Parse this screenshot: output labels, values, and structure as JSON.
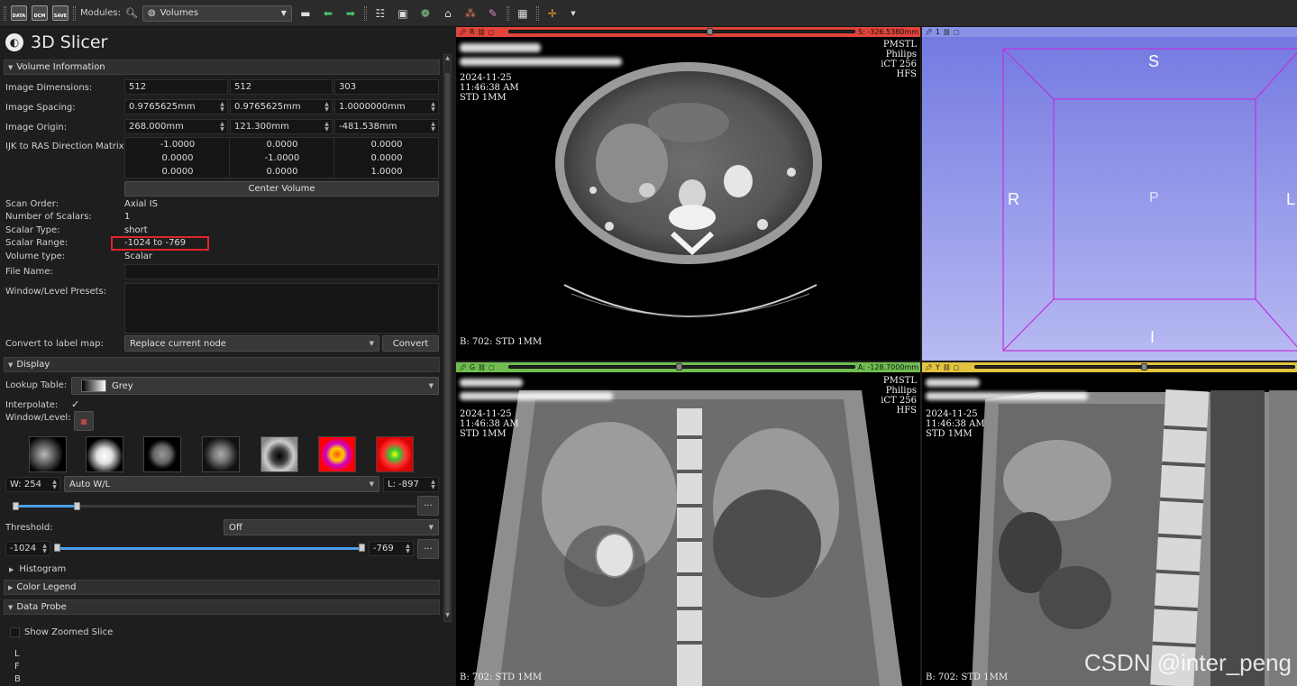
{
  "toolbar": {
    "data_label": "DATA",
    "dcm_label": "DCM",
    "save_label": "SAVE",
    "modules_label": "Modules:",
    "module_selected": "Volumes"
  },
  "app": {
    "title": "3D Slicer"
  },
  "volume_info": {
    "header": "Volume Information",
    "image_dimensions_label": "Image Dimensions:",
    "image_dimensions": [
      "512",
      "512",
      "303"
    ],
    "image_spacing_label": "Image Spacing:",
    "image_spacing": [
      "0.9765625mm",
      "0.9765625mm",
      "1.0000000mm"
    ],
    "image_origin_label": "Image Origin:",
    "image_origin": [
      "268.000mm",
      "121.300mm",
      "-481.538mm"
    ],
    "ijk_label": "IJK to RAS Direction Matrix:",
    "matrix": [
      [
        "-1.0000",
        "0.0000",
        "0.0000"
      ],
      [
        "0.0000",
        "-1.0000",
        "0.0000"
      ],
      [
        "0.0000",
        "0.0000",
        "1.0000"
      ]
    ],
    "center_volume": "Center Volume",
    "scan_order_label": "Scan Order:",
    "scan_order": "Axial IS",
    "num_scalars_label": "Number of Scalars:",
    "num_scalars": "1",
    "scalar_type_label": "Scalar Type:",
    "scalar_type": "short",
    "scalar_range_label": "Scalar Range:",
    "scalar_range": "-1024 to -769",
    "volume_type_label": "Volume type:",
    "volume_type": "Scalar",
    "file_name_label": "File Name:",
    "file_name": "",
    "wl_presets_label": "Window/Level Presets:",
    "convert_label": "Convert to label map:",
    "convert_option": "Replace current node",
    "convert_button": "Convert"
  },
  "display": {
    "header": "Display",
    "lookup_label": "Lookup Table:",
    "lookup_value": "Grey",
    "interpolate_label": "Interpolate:",
    "interpolate_checked": true,
    "wl_label": "Window/Level:",
    "w_value": "W: 254",
    "auto_wl": "Auto W/L",
    "l_value": "L: -897",
    "threshold_label": "Threshold:",
    "threshold_value": "Off",
    "thresh_min": "-1024",
    "thresh_max": "-769",
    "histogram": "Histogram",
    "color_legend": "Color Legend"
  },
  "data_probe": {
    "header": "Data Probe",
    "show_zoomed": "Show Zoomed Slice",
    "lines": [
      "L",
      "F",
      "B"
    ]
  },
  "views": {
    "red": {
      "letter": "R",
      "offset": "S: -326.5380mm",
      "slider": 0.58,
      "color": "#e0443a",
      "left_lines": [
        "2024-11-25",
        "11:46:38 AM",
        "STD 1MM"
      ],
      "right_lines": [
        "PMSTL",
        "Philips",
        "iCT 256",
        "HFS"
      ],
      "bottom": "B: 702: STD 1MM"
    },
    "green": {
      "letter": "G",
      "offset": "A: -128.7000mm",
      "slider": 0.49,
      "color": "#6fbd50",
      "left_lines": [
        "2024-11-25",
        "11:46:38 AM",
        "STD 1MM"
      ],
      "right_lines": [
        "PMSTL",
        "Philips",
        "iCT 256",
        "HFS"
      ],
      "bottom": "B: 702: STD 1MM"
    },
    "yellow": {
      "letter": "Y",
      "slider": 0.53,
      "color": "#e2c340",
      "left_lines": [
        "2024-11-25",
        "11:46:38 AM",
        "STD 1MM"
      ],
      "bottom": "B: 702: STD 1MM"
    },
    "threed": {
      "number": "1",
      "axes": {
        "S": "S",
        "I": "I",
        "R": "R",
        "L": "L",
        "P": "P"
      }
    }
  },
  "watermark": "CSDN @inter_peng"
}
